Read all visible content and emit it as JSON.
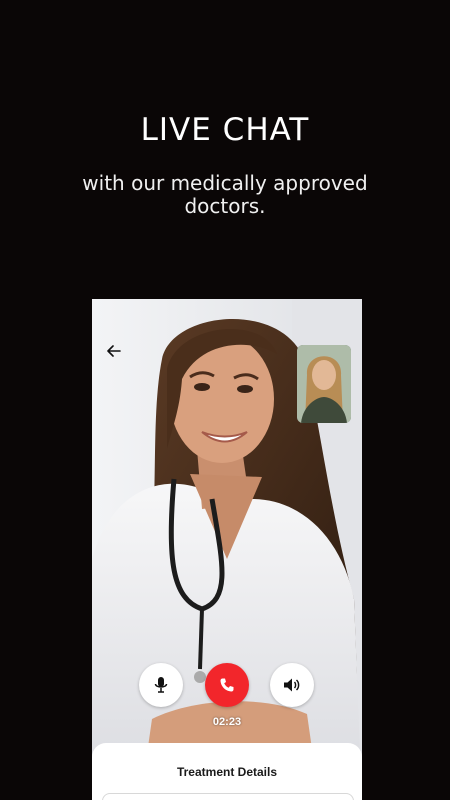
{
  "headline": "LIVE CHAT",
  "subline": "with our medically approved doctors.",
  "call": {
    "timer": "02:23",
    "end_color": "#f2262b"
  },
  "sheet": {
    "title": "Treatment Details"
  },
  "icons": {
    "back": "arrow-left-icon",
    "mic": "microphone-icon",
    "end": "phone-icon",
    "speaker": "speaker-icon"
  }
}
